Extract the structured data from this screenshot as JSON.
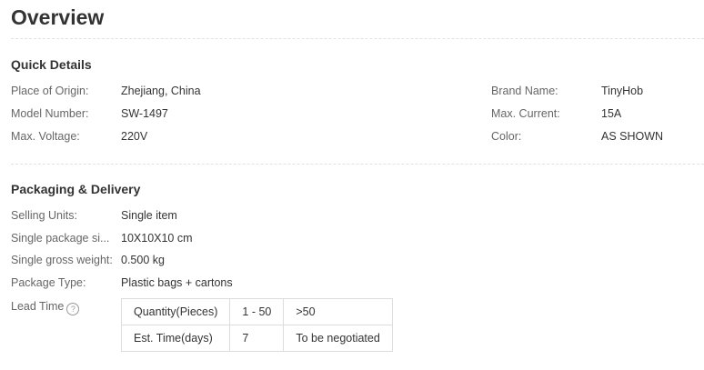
{
  "overview": {
    "title": "Overview"
  },
  "quick_details": {
    "title": "Quick Details",
    "left": [
      {
        "label": "Place of Origin:",
        "value": "Zhejiang, China"
      },
      {
        "label": "Model Number:",
        "value": "SW-1497"
      },
      {
        "label": "Max. Voltage:",
        "value": "220V"
      }
    ],
    "right": [
      {
        "label": "Brand Name:",
        "value": "TinyHob"
      },
      {
        "label": "Max. Current:",
        "value": "15A"
      },
      {
        "label": "Color:",
        "value": "AS SHOWN"
      }
    ]
  },
  "packaging": {
    "title": "Packaging & Delivery",
    "rows": [
      {
        "label": "Selling Units:",
        "value": "Single item"
      },
      {
        "label": "Single package si...",
        "value": "10X10X10 cm"
      },
      {
        "label": "Single gross weight:",
        "value": "0.500 kg"
      },
      {
        "label": "Package Type:",
        "value": "Plastic bags + cartons"
      }
    ],
    "lead_time": {
      "label": "Lead Time",
      "help_icon": "question-circle-icon",
      "help_glyph": "?",
      "table": [
        [
          "Quantity(Pieces)",
          "1 - 50",
          ">50"
        ],
        [
          "Est. Time(days)",
          "7",
          "To be negotiated"
        ]
      ]
    }
  }
}
